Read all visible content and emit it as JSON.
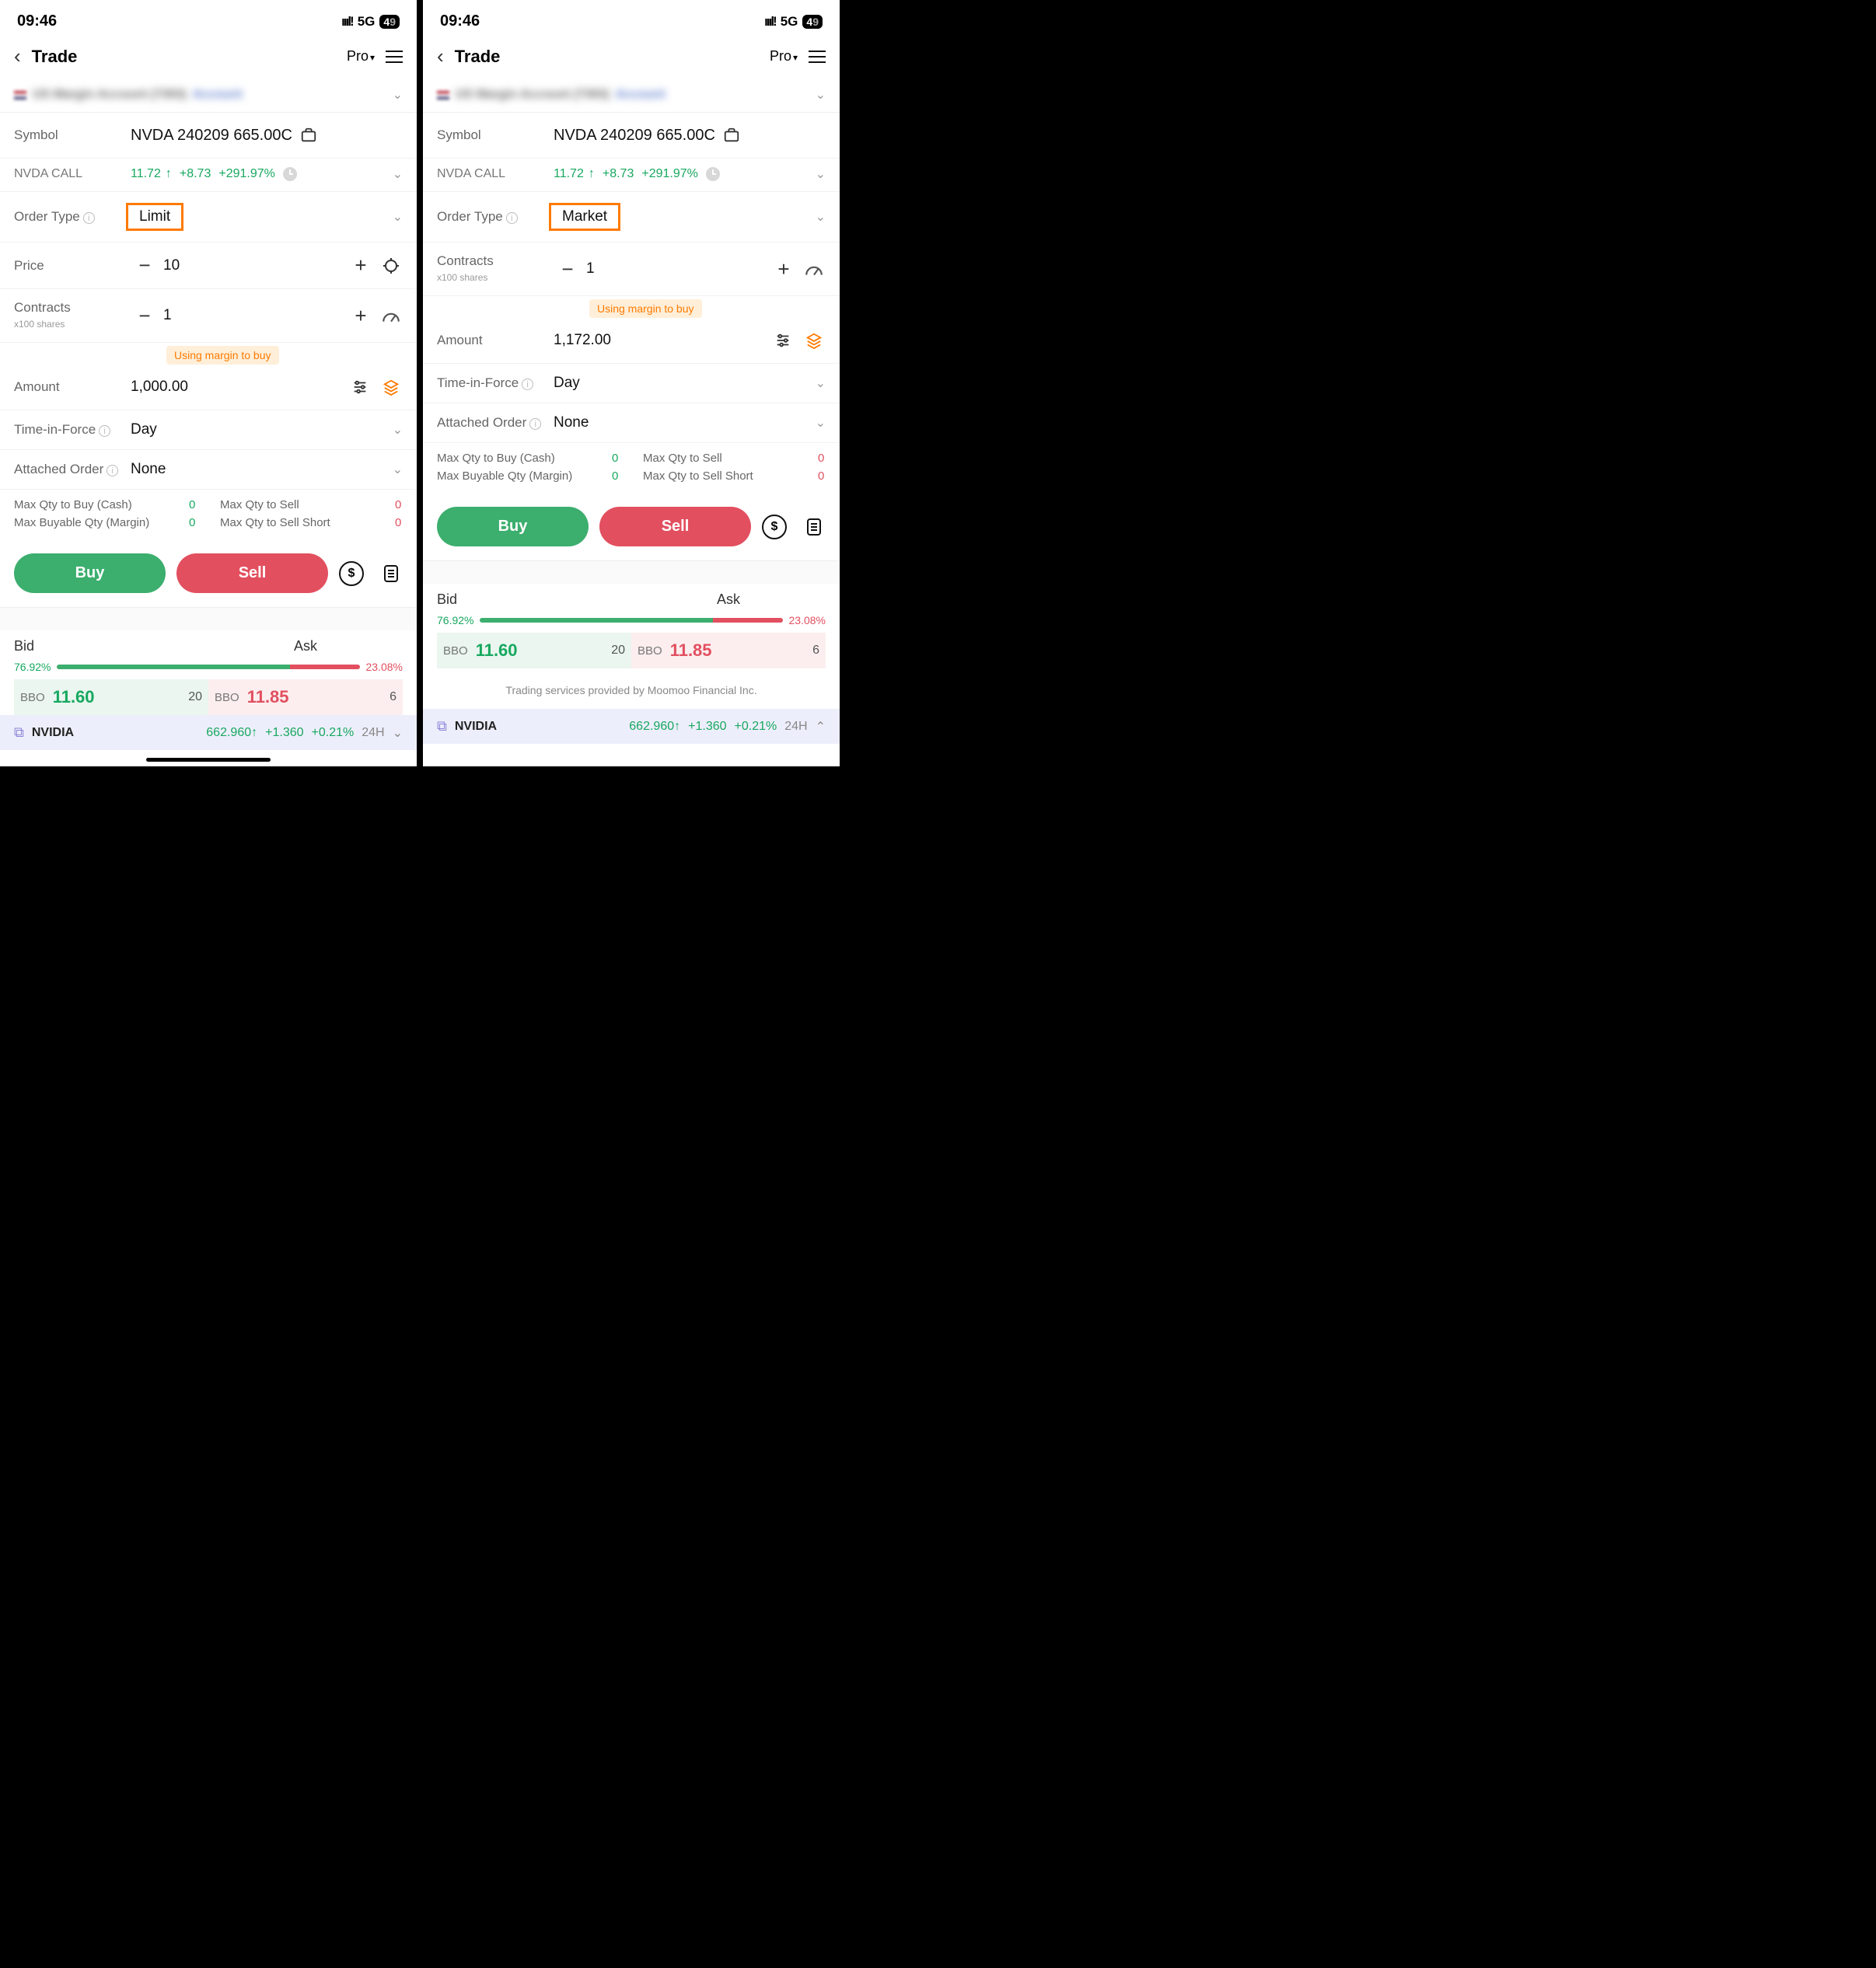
{
  "status": {
    "time": "09:46",
    "signal": "ıııl!",
    "network": "5G",
    "battery": "4",
    "battery_dim": "9"
  },
  "nav": {
    "title": "Trade",
    "mode": "Pro"
  },
  "account": {
    "name": "US Margin Account (7393)",
    "tag": "Account"
  },
  "symbol": {
    "label": "Symbol",
    "value": "NVDA 240209 665.00C"
  },
  "quote": {
    "name": "NVDA CALL",
    "price": "11.72",
    "arrow": "↑",
    "chg": "+8.73",
    "pct": "+291.97%"
  },
  "ordertype": {
    "label": "Order Type"
  },
  "left": {
    "ordertype_val": "Limit"
  },
  "right": {
    "ordertype_val": "Market"
  },
  "price": {
    "label": "Price",
    "val": "10"
  },
  "contracts": {
    "label": "Contracts",
    "sub": "x100 shares",
    "val": "1"
  },
  "margin_note": "Using margin to buy",
  "amount": {
    "label": "Amount",
    "left_val": "1,000.00",
    "right_val": "1,172.00"
  },
  "tif": {
    "label": "Time-in-Force",
    "val": "Day"
  },
  "attached": {
    "label": "Attached Order",
    "val": "None"
  },
  "maxqty": {
    "buy_cash_lbl": "Max Qty to Buy (Cash)",
    "buy_cash_val": "0",
    "buy_margin_lbl": "Max Buyable Qty (Margin)",
    "buy_margin_val": "0",
    "sell_lbl": "Max Qty to Sell",
    "sell_val": "0",
    "sell_short_lbl": "Max Qty to Sell Short",
    "sell_short_val": "0"
  },
  "buttons": {
    "buy": "Buy",
    "sell": "Sell"
  },
  "bidask": {
    "bid": "Bid",
    "ask": "Ask",
    "bid_pct": "76.92%",
    "ask_pct": "23.08%",
    "bbo": "BBO",
    "bid_price": "11.60",
    "bid_qty": "20",
    "ask_price": "11.85",
    "ask_qty": "6"
  },
  "ticker": {
    "name": "NVIDIA",
    "price": "662.960",
    "arrow": "↑",
    "chg": "+1.360",
    "pct": "+0.21%",
    "tf": "24H"
  },
  "footer": "Trading services provided by Moomoo Financial Inc."
}
